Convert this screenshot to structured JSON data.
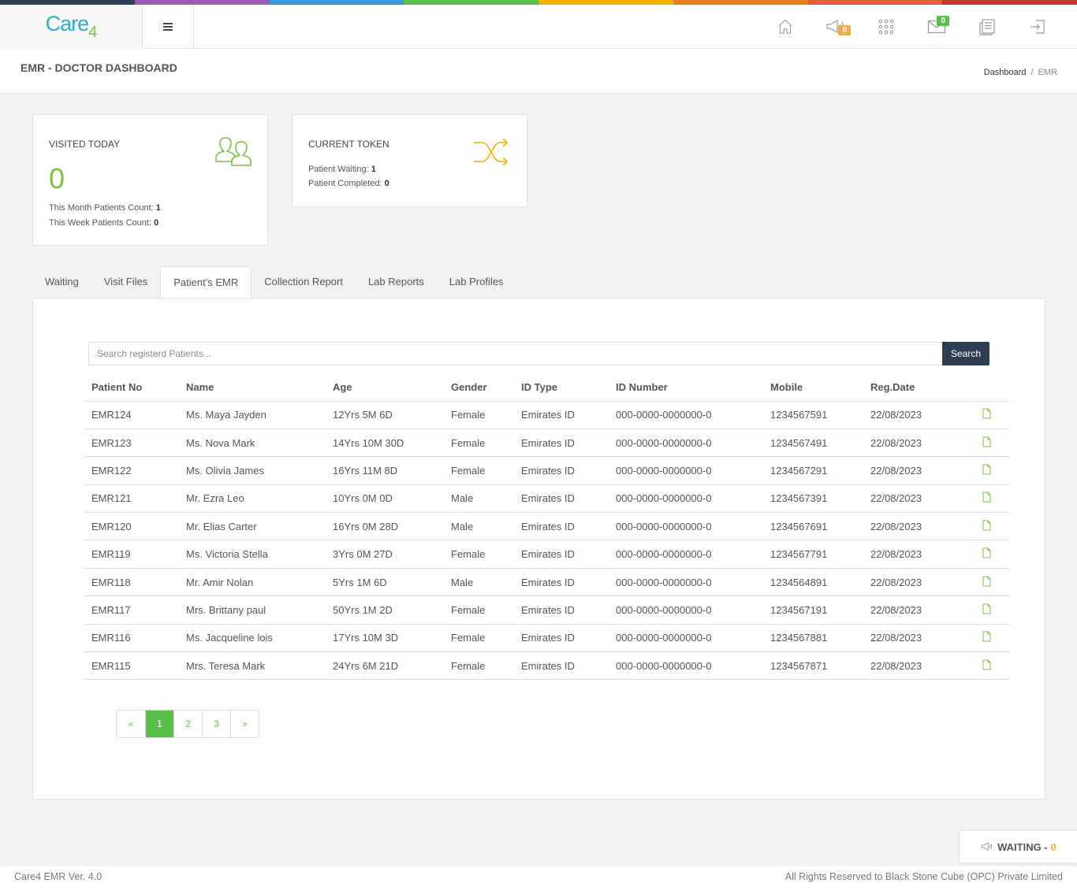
{
  "brand": {
    "logo_text": "Care",
    "logo_sub": "4",
    "colors": [
      "#2d3e50",
      "#9b59b6",
      "#3498db",
      "#5bc04a",
      "#f5b000",
      "#e67e22",
      "#e45d3a",
      "#c0392b"
    ]
  },
  "topbar": {
    "icons": [
      "home-icon",
      "megaphone-icon",
      "apps-grid-icon",
      "mail-icon",
      "notes-icon",
      "logout-icon"
    ],
    "announcement_badge": "0",
    "mail_badge": "0"
  },
  "header": {
    "title": "EMR - DOCTOR DASHBOARD",
    "breadcrumb_home": "Dashboard",
    "breadcrumb_sep": "/",
    "breadcrumb_current": "EMR"
  },
  "visited": {
    "title": "VISITED TODAY",
    "count": "0",
    "month_label": "This Month Patients Count:",
    "month_value": "1",
    "week_label": "This Week Patients Count:",
    "week_value": "0",
    "icon": "users-icon"
  },
  "token": {
    "title": "CURRENT TOKEN",
    "waiting_label": "Patient Waiting:",
    "waiting_value": "1",
    "completed_label": "Patient Completed:",
    "completed_value": "0",
    "icon": "shuffle-icon"
  },
  "tabs": [
    "Waiting",
    "Visit Files",
    "Patient's EMR",
    "Collection Report",
    "Lab Reports",
    "Lab Profiles"
  ],
  "active_tab": "Patient's EMR",
  "search": {
    "placeholder": "Search registerd Patients...",
    "button": "Search"
  },
  "table": {
    "headers": [
      "Patient No",
      "Name",
      "Age",
      "Gender",
      "ID Type",
      "ID Number",
      "Mobile",
      "Reg.Date"
    ],
    "rows": [
      [
        "EMR124",
        "Ms. Maya Jayden",
        "12Yrs 5M 6D",
        "Female",
        "Emirates ID",
        "000-0000-0000000-0",
        "1234567591",
        "22/08/2023"
      ],
      [
        "EMR123",
        "Ms. Nova Mark",
        "14Yrs 10M 30D",
        "Female",
        "Emirates ID",
        "000-0000-0000000-0",
        "1234567491",
        "22/08/2023"
      ],
      [
        "EMR122",
        "Ms. Olivia James",
        "16Yrs 11M 8D",
        "Female",
        "Emirates ID",
        "000-0000-0000000-0",
        "1234567291",
        "22/08/2023"
      ],
      [
        "EMR121",
        "Mr. Ezra Leo",
        "10Yrs 0M 0D",
        "Male",
        "Emirates ID",
        "000-0000-0000000-0",
        "1234567391",
        "22/08/2023"
      ],
      [
        "EMR120",
        "Mr. Elias Carter",
        "16Yrs 0M 28D",
        "Male",
        "Emirates ID",
        "000-0000-0000000-0",
        "1234567691",
        "22/08/2023"
      ],
      [
        "EMR119",
        "Ms. Victoria Stella",
        "3Yrs 0M 27D",
        "Female",
        "Emirates ID",
        "000-0000-0000000-0",
        "1234567791",
        "22/08/2023"
      ],
      [
        "EMR118",
        "Mr. Amir Nolan",
        "5Yrs 1M 6D",
        "Male",
        "Emirates ID",
        "000-0000-0000000-0",
        "1234564891",
        "22/08/2023"
      ],
      [
        "EMR117",
        "Mrs. Brittany paul",
        "50Yrs 1M 2D",
        "Female",
        "Emirates ID",
        "000-0000-0000000-0",
        "1234567191",
        "22/08/2023"
      ],
      [
        "EMR116",
        "Ms. Jacqueline lois",
        "17Yrs 10M 3D",
        "Female",
        "Emirates ID",
        "000-0000-0000000-0",
        "1234567881",
        "22/08/2023"
      ],
      [
        "EMR115",
        "Mrs. Teresa Mark",
        "24Yrs 6M 21D",
        "Female",
        "Emirates ID",
        "000-0000-0000000-0",
        "1234567871",
        "22/08/2023"
      ]
    ],
    "row_action_icon": "file-icon"
  },
  "pagination": {
    "prev": "«",
    "pages": [
      "1",
      "2",
      "3"
    ],
    "current": "1",
    "next": "»"
  },
  "waiting_widget": {
    "label": "WAITING -",
    "count": "0",
    "icon": "megaphone-icon"
  },
  "footer": {
    "version": "Care4 EMR Ver. 4.0",
    "rights": "All Rights Reserved to Black Stone Cube (OPC) Private Limited"
  }
}
